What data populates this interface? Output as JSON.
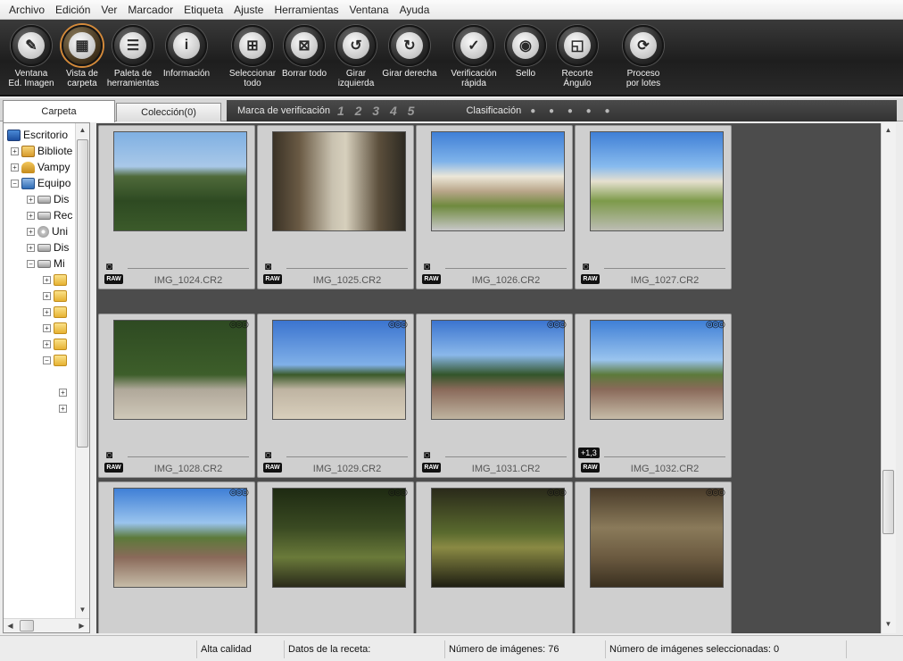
{
  "menubar": [
    "Archivo",
    "Edición",
    "Ver",
    "Marcador",
    "Etiqueta",
    "Ajuste",
    "Herramientas",
    "Ventana",
    "Ayuda"
  ],
  "toolbar": [
    {
      "label": "Ventana\nEd. Imagen",
      "icon": "edit-window-icon"
    },
    {
      "label": "Vista de\ncarpeta",
      "icon": "folder-view-icon"
    },
    {
      "label": "Paleta de\nherramientas",
      "icon": "tool-palette-icon"
    },
    {
      "label": "Información",
      "icon": "info-icon"
    },
    {
      "label": "Seleccionar\ntodo",
      "icon": "select-all-icon"
    },
    {
      "label": "Borrar todo",
      "icon": "clear-all-icon"
    },
    {
      "label": "Girar izquierda",
      "icon": "rotate-left-icon"
    },
    {
      "label": "Girar derecha",
      "icon": "rotate-right-icon"
    },
    {
      "label": "Verificación\nrápida",
      "icon": "quick-check-icon"
    },
    {
      "label": "Sello",
      "icon": "stamp-icon"
    },
    {
      "label": "Recorte\nÁngulo",
      "icon": "crop-angle-icon"
    },
    {
      "label": "Proceso\npor lotes",
      "icon": "batch-process-icon"
    }
  ],
  "tabs": {
    "folder": "Carpeta",
    "collection": "Colección(0)"
  },
  "filter": {
    "check_label": "Marca de verificación",
    "check_values": "1 2 3 4 5",
    "rating_label": "Clasificación",
    "rating_dots": "● ● ● ● ●"
  },
  "tree": [
    {
      "label": "Escritorio",
      "icon": "desktop-icon"
    },
    {
      "label": "Bibliote",
      "icon": "library-icon"
    },
    {
      "label": "Vampy",
      "icon": "user-folder-icon"
    },
    {
      "label": "Equipo",
      "icon": "computer-icon"
    },
    {
      "label": "Dis",
      "icon": "drive-icon"
    },
    {
      "label": "Rec",
      "icon": "drive-icon"
    },
    {
      "label": "Uni",
      "icon": "cd-drive-icon"
    },
    {
      "label": "Dis",
      "icon": "drive-icon"
    },
    {
      "label": "Mi",
      "icon": "drive-icon"
    }
  ],
  "images": [
    {
      "name": "IMG_1024.CR2",
      "raw": "RAW",
      "badge": ""
    },
    {
      "name": "IMG_1025.CR2",
      "raw": "RAW",
      "badge": ""
    },
    {
      "name": "IMG_1026.CR2",
      "raw": "RAW",
      "badge": ""
    },
    {
      "name": "IMG_1027.CR2",
      "raw": "RAW",
      "badge": ""
    },
    {
      "name": "IMG_1028.CR2",
      "raw": "RAW",
      "badge": ""
    },
    {
      "name": "IMG_1029.CR2",
      "raw": "RAW",
      "badge": ""
    },
    {
      "name": "IMG_1031.CR2",
      "raw": "RAW",
      "badge": ""
    },
    {
      "name": "IMG_1032.CR2",
      "raw": "RAW",
      "badge": "+1,3"
    },
    {
      "name": "",
      "raw": "",
      "badge": ""
    },
    {
      "name": "",
      "raw": "",
      "badge": ""
    },
    {
      "name": "",
      "raw": "",
      "badge": ""
    },
    {
      "name": "",
      "raw": "",
      "badge": ""
    }
  ],
  "status": {
    "quality": "Alta calidad",
    "recipe": "Datos de la receta:",
    "count": "Número de imágenes: 76",
    "selected": "Número de imágenes seleccionadas: 0"
  }
}
